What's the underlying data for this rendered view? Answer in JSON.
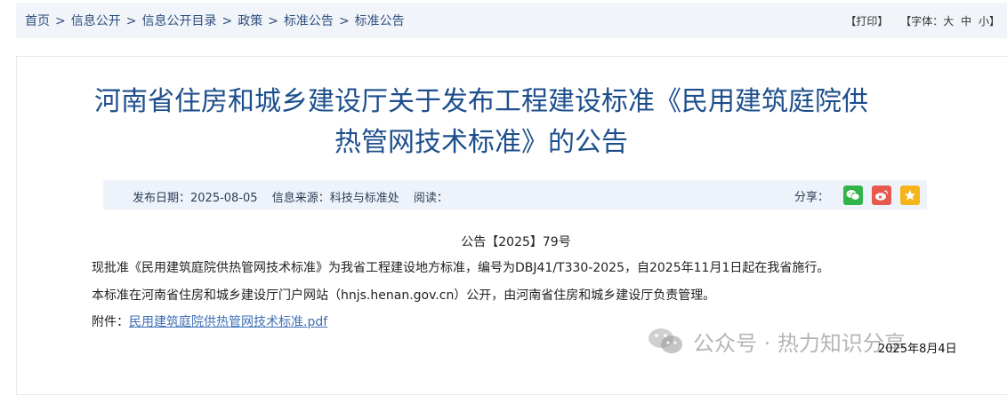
{
  "breadcrumb": {
    "items": [
      "首页",
      "信息公开",
      "信息公开目录",
      "政策",
      "标准公告",
      "标准公告"
    ],
    "separator": ">"
  },
  "tools": {
    "print": "【打印】",
    "font_prefix": "【字体：",
    "font_large": "大",
    "font_medium": "中",
    "font_small": "小",
    "font_suffix": "】"
  },
  "article": {
    "title_line1": "河南省住房和城乡建设厅关于发布工程建设标准《民用建筑庭院供",
    "title_line2": "热管网技术标准》的公告",
    "publish_date": "发布日期：2025-08-05",
    "source": "信息来源：科技与标准处",
    "reads": "阅读：",
    "share_label": "分享：",
    "doc_number": "公告【2025】79号",
    "paragraph1": "现批准《民用建筑庭院供热管网技术标准》为我省工程建设地方标准，编号为DBJ41/T330-2025，自2025年11月1日起在我省施行。",
    "paragraph2": "本标准在河南省住房和城乡建设厅门户网站（hnjs.henan.gov.cn）公开，由河南省住房和城乡建设厅负责管理。",
    "attachment_label": "附件：",
    "attachment_link": "民用建筑庭院供热管网技术标准.pdf",
    "sign_date": "2025年8月4日"
  },
  "watermark": {
    "text": "公众号 · 热力知识分享"
  },
  "colors": {
    "title": "#1d4f8c",
    "link": "#3d6fb5",
    "topbar_bg": "#f1f4f9",
    "meta_bg": "#eef3fb",
    "wechat": "#31b44b",
    "weibo": "#e8584f",
    "qzone": "#f4b41a"
  },
  "icons": {
    "share_wechat": "wechat-icon",
    "share_weibo": "weibo-icon",
    "share_qzone": "qzone-star-icon",
    "watermark": "wechat-official-account-icon"
  }
}
